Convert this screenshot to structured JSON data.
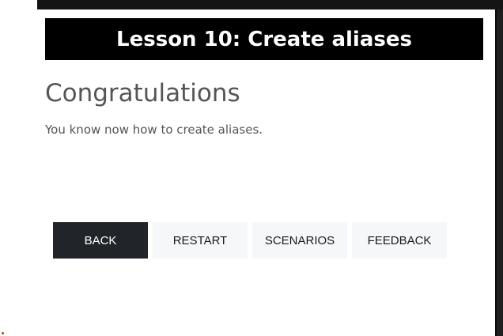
{
  "top_strip": {
    "text": ""
  },
  "lesson": {
    "title": "Lesson 10: Create aliases",
    "heading": "Congratulations",
    "message": "You know now how to create aliases."
  },
  "buttons": [
    {
      "label": "BACK"
    },
    {
      "label": "RESTART"
    },
    {
      "label": "SCENARIOS"
    },
    {
      "label": "FEEDBACK"
    }
  ],
  "colors": {
    "title_bar_bg": "#000000",
    "primary_button_bg": "#212529",
    "secondary_button_bg": "#f6f7f9",
    "text_gray": "#555555"
  }
}
